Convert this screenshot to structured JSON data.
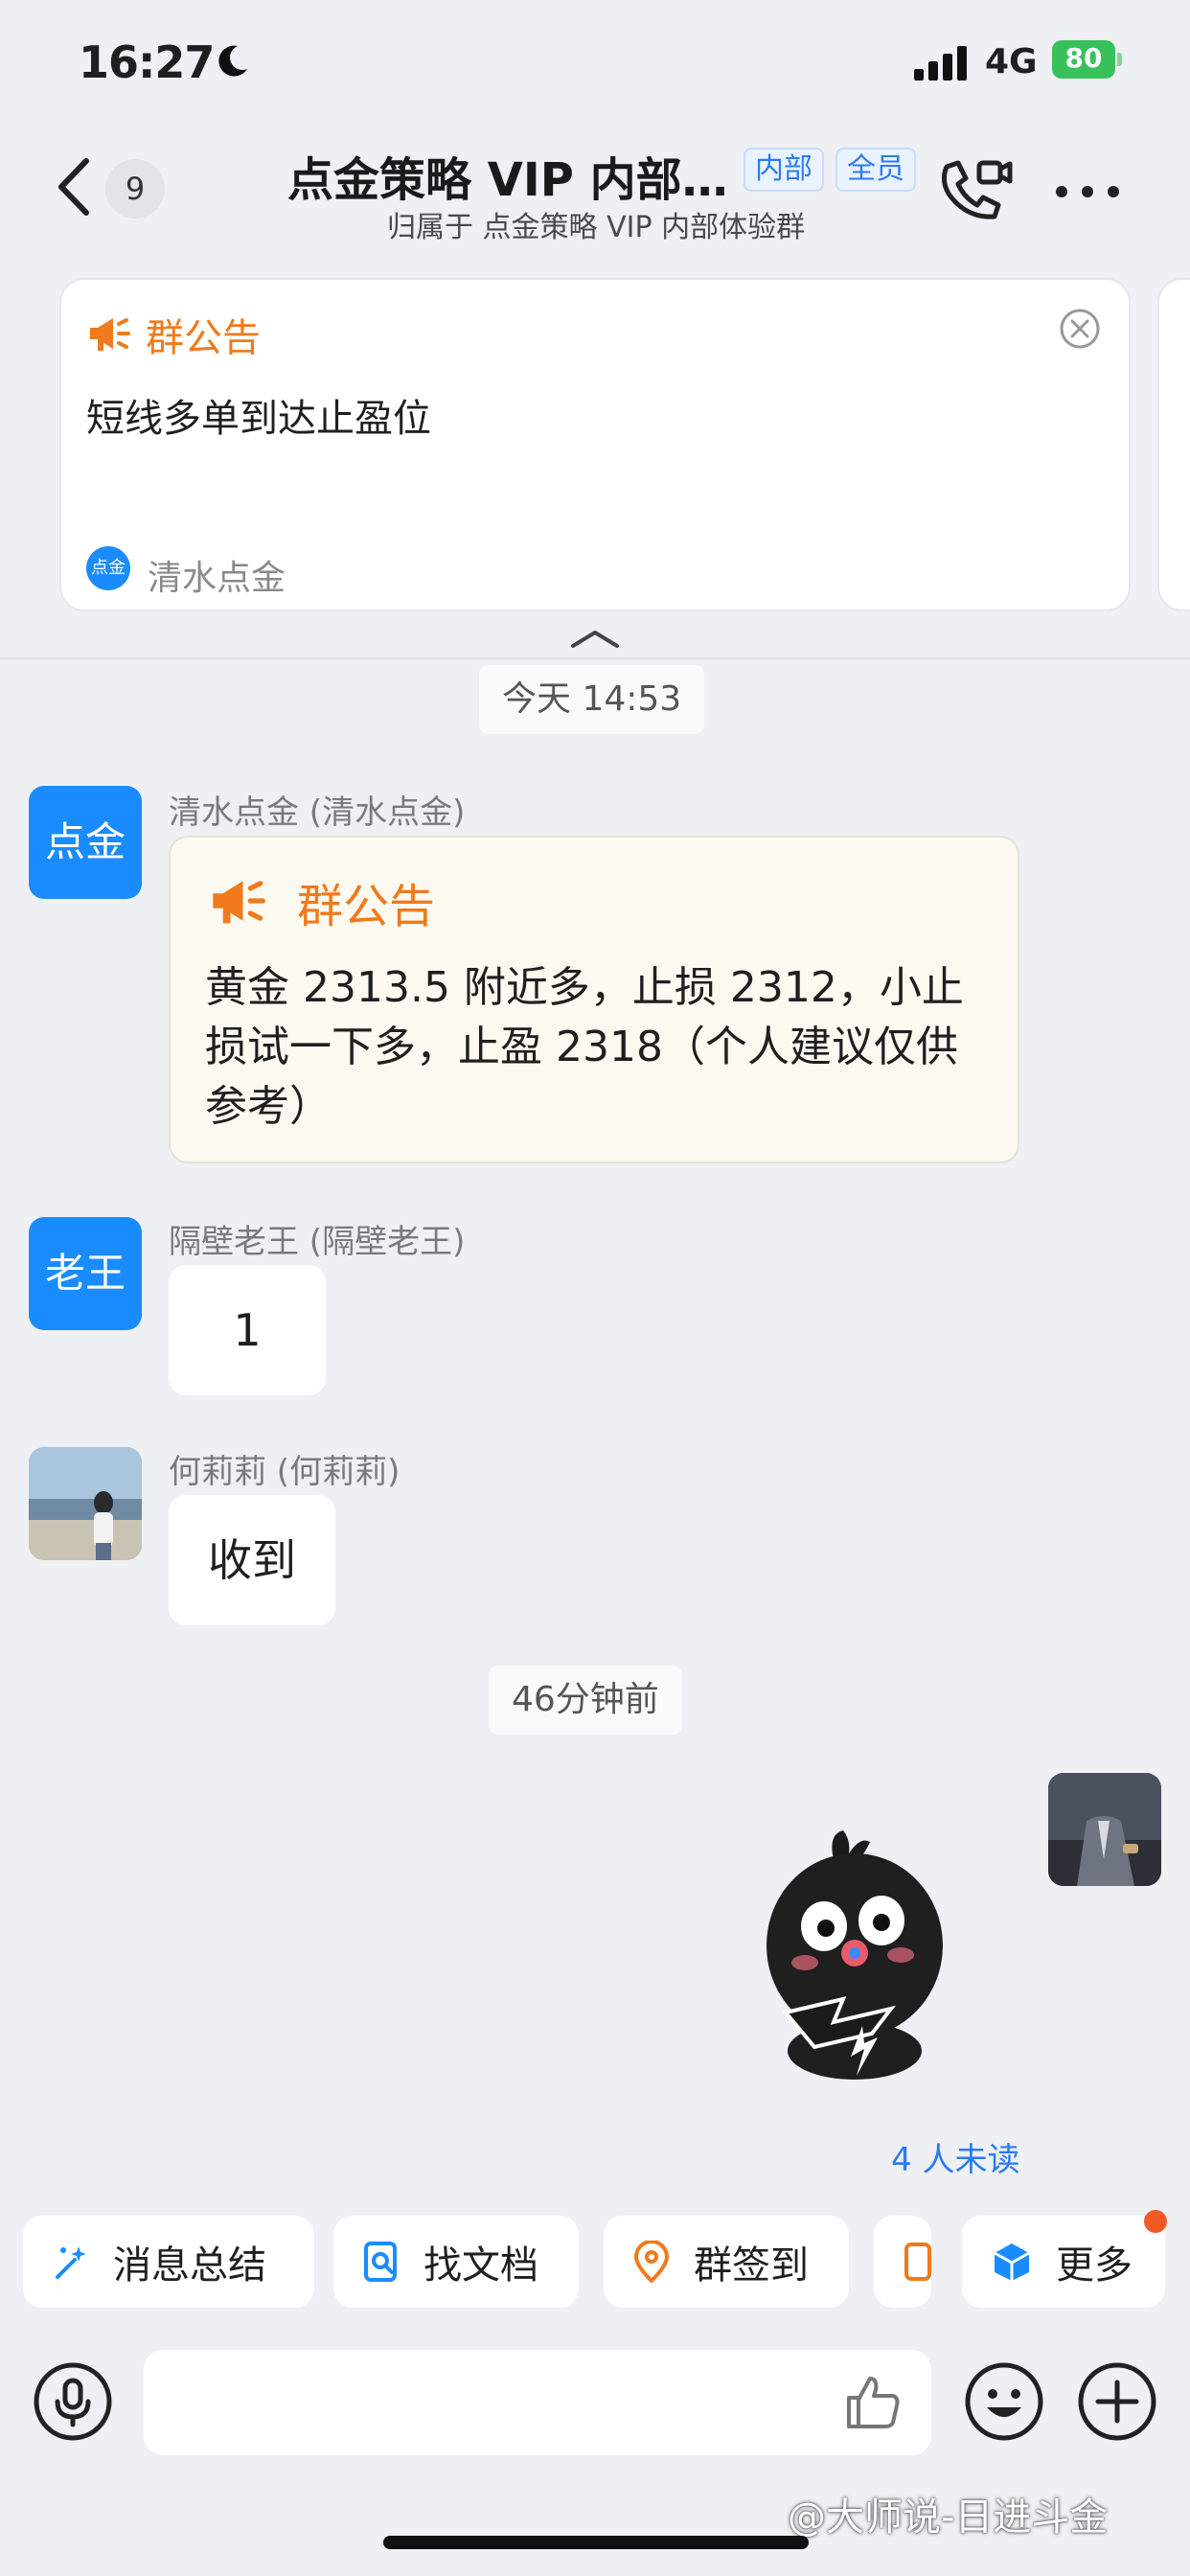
{
  "status_bar": {
    "time": "16:27",
    "network": "4G",
    "battery": "80"
  },
  "header": {
    "unread_badge": "9",
    "title": "点金策略 VIP 内部…",
    "tag_inner": "内部",
    "tag_all": "全员",
    "subtitle": "归属于 点金策略 VIP 内部体验群"
  },
  "pinned_notice": {
    "heading": "群公告",
    "text": "短线多单到达止盈位",
    "author_avatar": "点金",
    "author": "清水点金"
  },
  "messages": {
    "timestamp_1": "今天 14:53",
    "msg1": {
      "avatar": "点金",
      "sender": "清水点金 (清水点金)",
      "heading": "群公告",
      "body": "黄金 2313.5 附近多，止损 2312，小止损试一下多，止盈 2318（个人建议仅供参考）"
    },
    "msg2": {
      "avatar": "老王",
      "sender": "隔壁老王 (隔壁老王)",
      "text": "1"
    },
    "msg3": {
      "sender": "何莉莉 (何莉莉)",
      "text": "收到"
    },
    "timestamp_2": "46分钟前",
    "unread": "4 人未读"
  },
  "quick_actions": [
    "消息总结",
    "找文档",
    "群签到",
    "更多"
  ],
  "watermark": "@大师说-日进斗金",
  "colors": {
    "accent": "#1a8cff",
    "announcement": "#f07a1c",
    "link": "#2a7bf6",
    "badge_dot": "#f05a24"
  },
  "icons": [
    "moon-icon",
    "signal-icon",
    "battery-icon",
    "back-icon",
    "video-call-icon",
    "more-icon",
    "megaphone-icon",
    "close-icon",
    "chevron-up-icon",
    "sparkle-icon",
    "doc-search-icon",
    "checkin-icon",
    "cube-icon",
    "mic-icon",
    "thumbs-up-icon",
    "emoji-icon",
    "plus-icon"
  ]
}
